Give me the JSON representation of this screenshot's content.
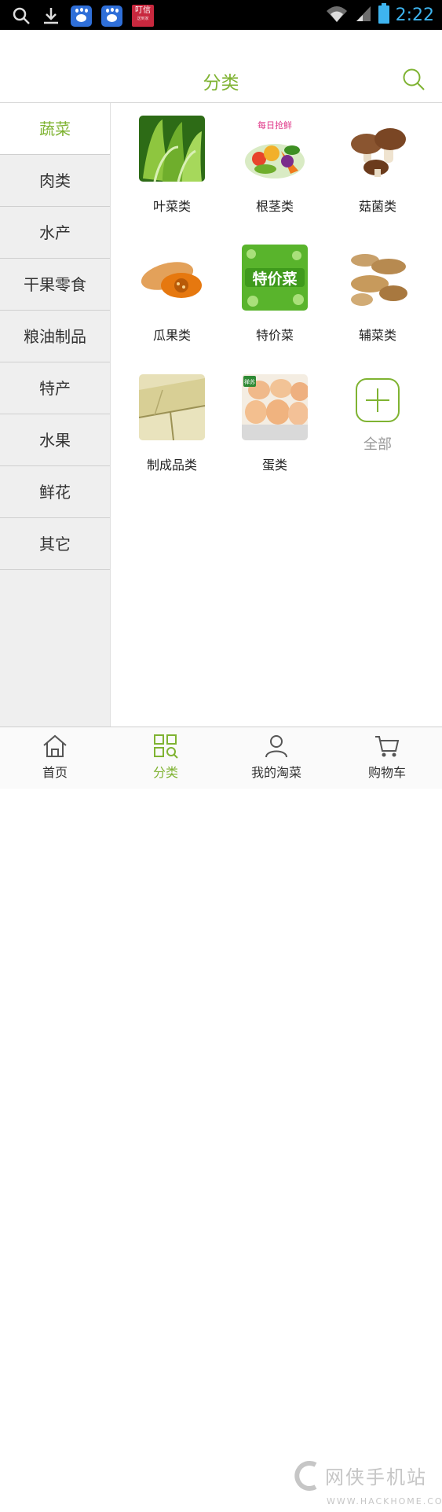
{
  "status_bar": {
    "time": "2:22",
    "notif_dingtao_text": "叮信",
    "notif_dingtao_sub": "送到家"
  },
  "header": {
    "title": "分类"
  },
  "sidebar": {
    "items": [
      {
        "label": "蔬菜",
        "active": true
      },
      {
        "label": "肉类"
      },
      {
        "label": "水产"
      },
      {
        "label": "干果零食"
      },
      {
        "label": "粮油制品"
      },
      {
        "label": "特产"
      },
      {
        "label": "水果"
      },
      {
        "label": "鲜花"
      },
      {
        "label": "其它"
      }
    ]
  },
  "grid": {
    "items": [
      {
        "label": "叶菜类",
        "image": "leafy-greens"
      },
      {
        "label": "根茎类",
        "image": "root-vegetables",
        "image_text": "每日抢鲜"
      },
      {
        "label": "菇菌类",
        "image": "mushrooms"
      },
      {
        "label": "瓜果类",
        "image": "pumpkin"
      },
      {
        "label": "特价菜",
        "image": "special-offer",
        "image_text": "特价菜"
      },
      {
        "label": "辅菜类",
        "image": "ginger"
      },
      {
        "label": "制成品类",
        "image": "tofu"
      },
      {
        "label": "蛋类",
        "image": "eggs",
        "image_text": "禅苏"
      }
    ],
    "all_label": "全部"
  },
  "bottom_nav": {
    "tabs": [
      {
        "label": "首页",
        "icon": "home-icon"
      },
      {
        "label": "分类",
        "icon": "category-icon",
        "active": true
      },
      {
        "label": "我的淘菜",
        "icon": "user-icon"
      },
      {
        "label": "购物车",
        "icon": "cart-icon"
      }
    ]
  },
  "watermark": {
    "text": "网侠手机站",
    "url": "WWW.HACKHOME.COM"
  },
  "colors": {
    "accent": "#7fb332",
    "status_bar": "#000000",
    "clock": "#3eb4ef"
  }
}
